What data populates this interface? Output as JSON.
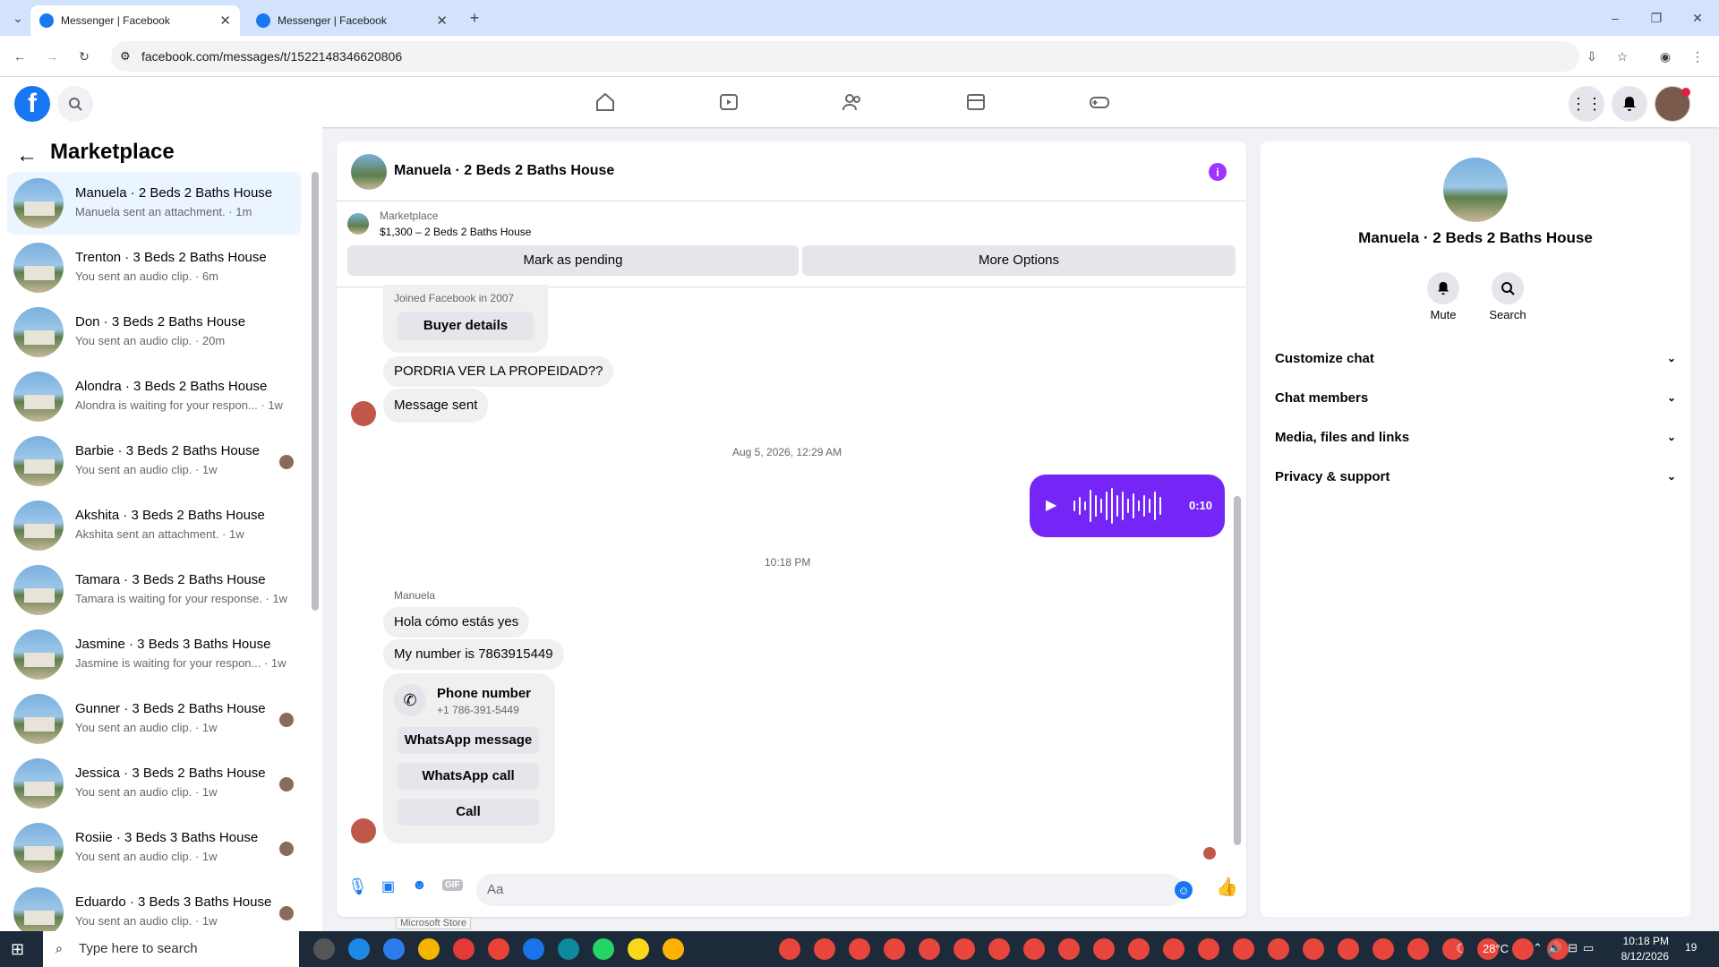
{
  "browser": {
    "tabs": [
      {
        "label": "Messenger | Facebook"
      },
      {
        "label": "Messenger | Facebook"
      }
    ],
    "url": "facebook.com/messages/t/1522148346620806"
  },
  "sidebar": {
    "title": "Marketplace",
    "conversations": [
      {
        "name": "Manuela · 2 Beds 2 Baths House",
        "preview": "Manuela sent an attachment. · 1m"
      },
      {
        "name": "Trenton · 3 Beds 2 Baths House",
        "preview": "You sent an audio clip. · 6m"
      },
      {
        "name": "Don · 3 Beds 2 Baths House",
        "preview": "You sent an audio clip. · 20m"
      },
      {
        "name": "Alondra · 3 Beds 2 Baths House",
        "preview": "Alondra is waiting for your respon... · 1w"
      },
      {
        "name": "Barbie · 3 Beds 2 Baths House",
        "preview": "You sent an audio clip. · 1w"
      },
      {
        "name": "Akshita · 3 Beds 2 Baths House",
        "preview": "Akshita sent an attachment. · 1w"
      },
      {
        "name": "Tamara · 3 Beds 2 Baths House",
        "preview": "Tamara is waiting for your response. · 1w"
      },
      {
        "name": "Jasmine · 3 Beds 3 Baths House",
        "preview": "Jasmine is waiting for your respon... · 1w"
      },
      {
        "name": "Gunner · 3 Beds 2 Baths House",
        "preview": "You sent an audio clip. · 1w"
      },
      {
        "name": "Jessica · 3 Beds 2 Baths House",
        "preview": "You sent an audio clip. · 1w"
      },
      {
        "name": "Rosiie · 3 Beds 3 Baths House",
        "preview": "You sent an audio clip. · 1w"
      },
      {
        "name": "Eduardo · 3 Beds 3 Baths House",
        "preview": "You sent an audio clip. · 1w"
      }
    ]
  },
  "chat": {
    "title": "Manuela · 2 Beds 2 Baths House",
    "listing": {
      "label": "Marketplace",
      "price_title": "$1,300 – 2 Beds 2 Baths House"
    },
    "mark_pending": "Mark as pending",
    "more_options": "More Options",
    "joined": "Joined Facebook in 2007",
    "buyer_details": "Buyer details",
    "msg1": "PORDRIA VER LA PROPEIDAD??",
    "msg2": "Message sent",
    "ts1": "Aug 5, 2026, 12:29 AM",
    "audio_duration": "0:10",
    "ts2": "10:18 PM",
    "sender": "Manuela",
    "msg3": "Hola cómo estás yes",
    "msg4": "My number is 7863915449",
    "phone_card": {
      "title": "Phone number",
      "number": "+1 786-391-5449",
      "whatsapp_message": "WhatsApp message",
      "whatsapp_call": "WhatsApp call",
      "call": "Call"
    },
    "composer_placeholder": "Aa",
    "tooltip": "Microsoft Store"
  },
  "details": {
    "name": "Manuela · 2 Beds 2 Baths House",
    "mute": "Mute",
    "search": "Search",
    "sections": [
      "Customize chat",
      "Chat members",
      "Media, files and links",
      "Privacy & support"
    ]
  },
  "taskbar": {
    "search_placeholder": "Type here to search",
    "weather": "28°C",
    "time": "10:18 PM",
    "date": "8/12/2026",
    "notif_count": "19"
  },
  "colors": {
    "accent": "#1877f2",
    "audio": "#7526f7",
    "info": "#a033ff"
  }
}
